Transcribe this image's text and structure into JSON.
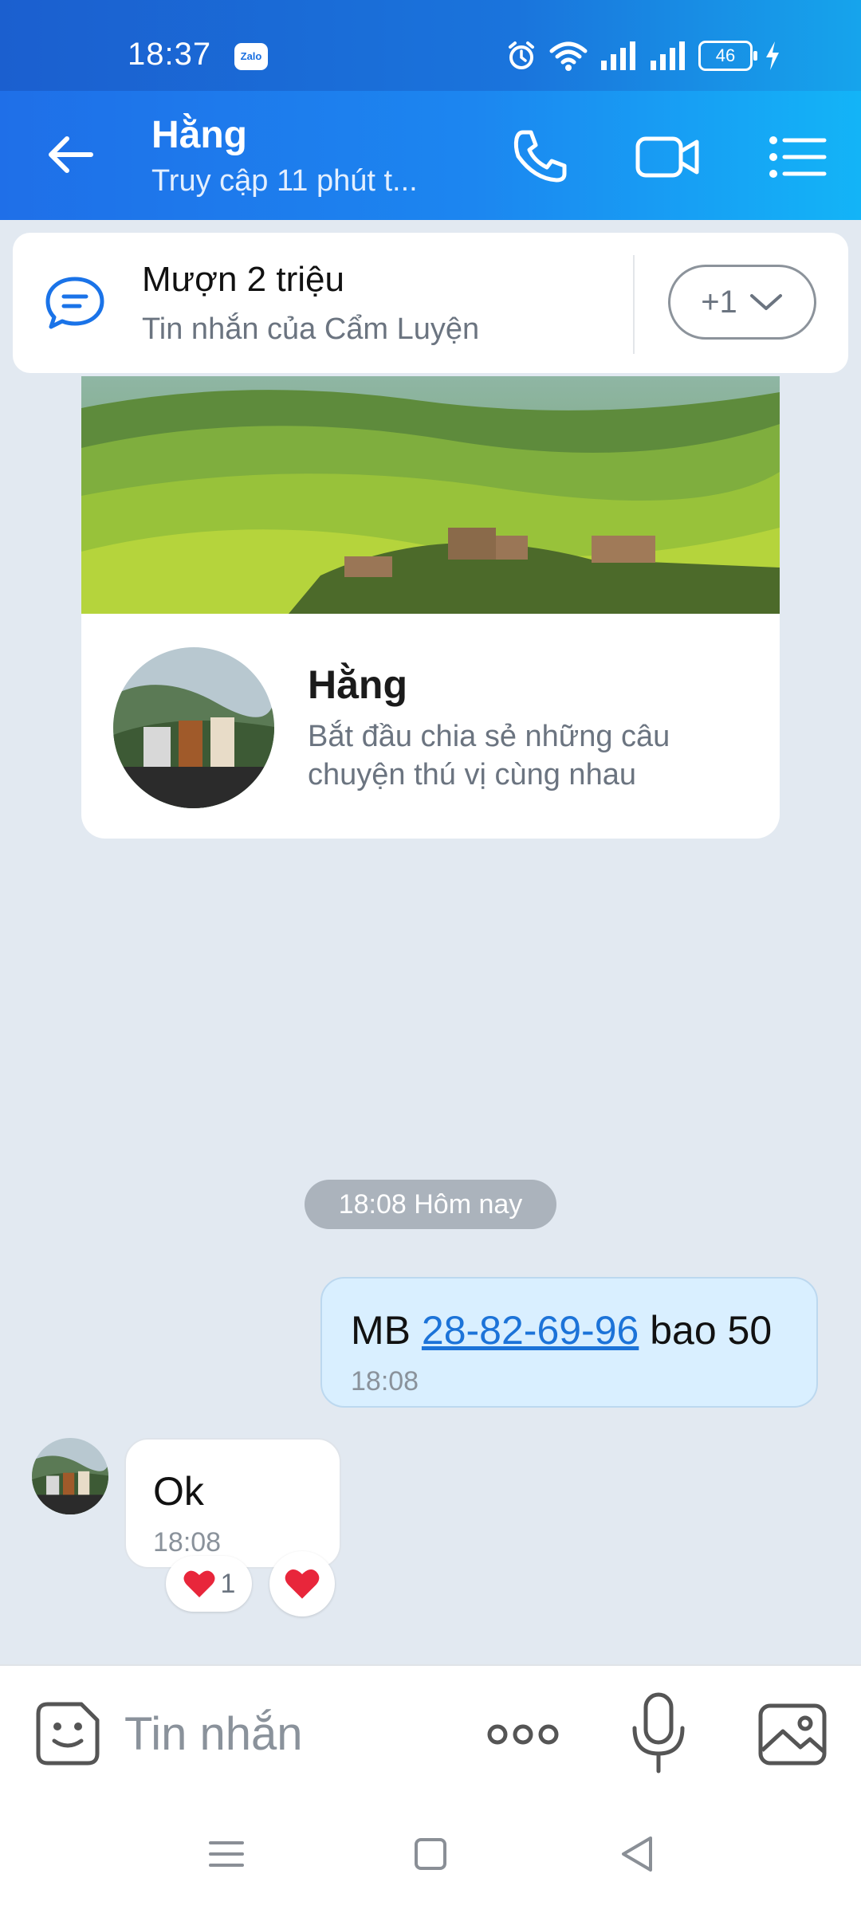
{
  "status_bar": {
    "time": "18:37",
    "app_badge": "Zalo",
    "battery_level": "46"
  },
  "header": {
    "title": "Hằng",
    "subtitle": "Truy cập 11 phút t..."
  },
  "pinned_message": {
    "title": "Mượn 2 triệu",
    "subtitle": "Tin nhắn của Cẩm Luyện",
    "more_label": "+1"
  },
  "profile_card": {
    "name": "Hằng",
    "description": "Bắt đầu chia sẻ những câu chuyện thú vị cùng nhau"
  },
  "timeline": {
    "time_chip": "18:08 Hôm nay"
  },
  "messages": {
    "sent": {
      "prefix": "MB",
      "link": "28-82-69-96",
      "suffix": "bao 50",
      "time": "18:08"
    },
    "received": {
      "text": "Ok",
      "time": "18:08",
      "reaction_count": "1"
    }
  },
  "input": {
    "placeholder": "Tin nhắn"
  },
  "colors": {
    "header_start": "#1f6fe8",
    "header_end": "#13b4f7",
    "sent_bubble": "#d9efff",
    "link": "#1c73d8",
    "heart": "#e8263b",
    "background": "#e2e9f1"
  }
}
